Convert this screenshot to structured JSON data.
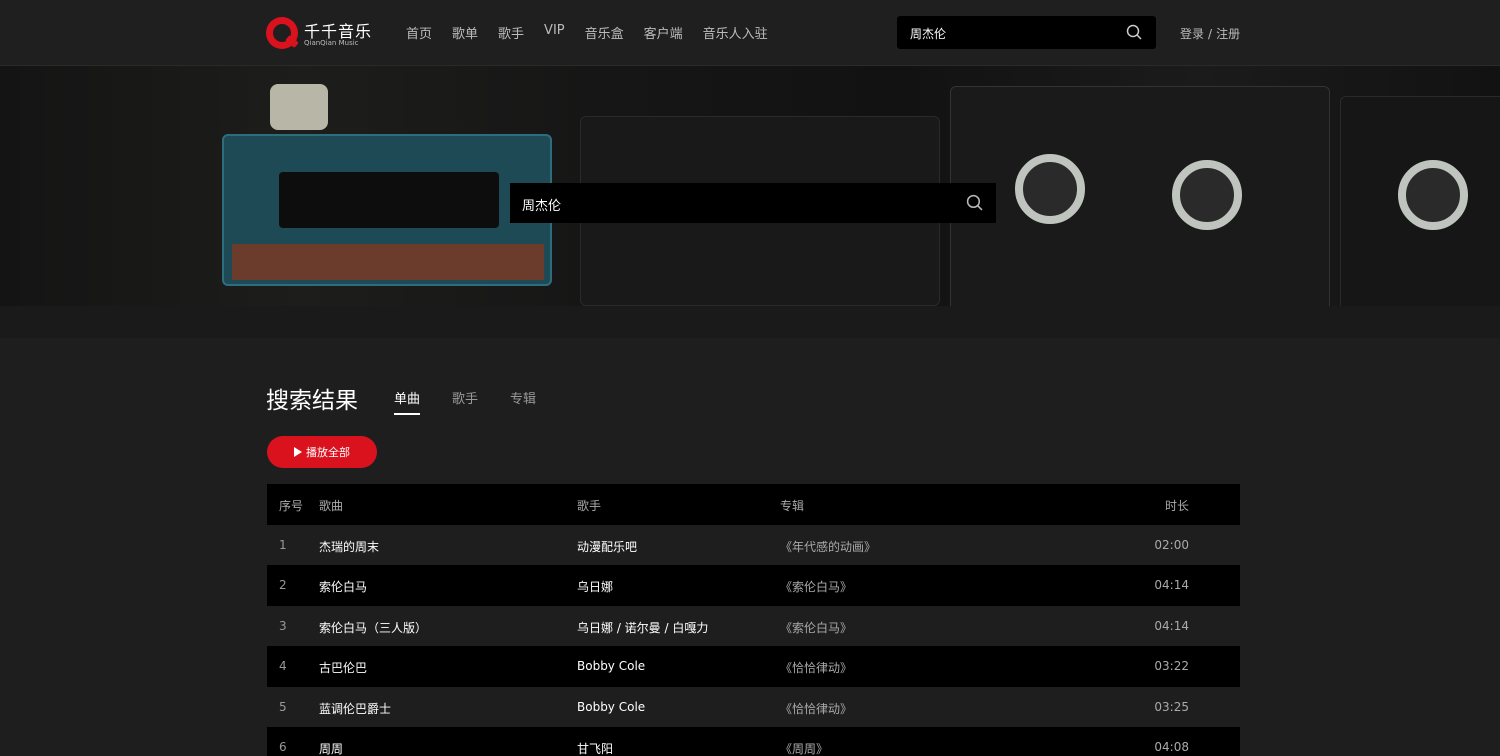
{
  "header": {
    "logo_cn": "千千音乐",
    "logo_en": "QianQian Music",
    "nav": [
      "首页",
      "歌单",
      "歌手",
      "VIP",
      "音乐盒",
      "客户端",
      "音乐人入驻"
    ],
    "search_value": "周杰伦",
    "login": "登录",
    "auth_sep": "/",
    "register": "注册"
  },
  "banner": {
    "search_value": "周杰伦"
  },
  "results": {
    "title": "搜索结果",
    "tabs": [
      "单曲",
      "歌手",
      "专辑"
    ],
    "active_tab": "单曲",
    "play_all": "播放全部",
    "columns": {
      "idx": "序号",
      "song": "歌曲",
      "artist": "歌手",
      "album": "专辑",
      "duration": "时长"
    },
    "rows": [
      {
        "idx": "1",
        "song": "杰瑞的周末",
        "artist": "动漫配乐吧",
        "album": "《年代感的动画》",
        "duration": "02:00"
      },
      {
        "idx": "2",
        "song": "索伦白马",
        "artist": "乌日娜",
        "album": "《索伦白马》",
        "duration": "04:14"
      },
      {
        "idx": "3",
        "song": "索伦白马（三人版）",
        "artist": "乌日娜 / 诺尔曼 / 白嘎力",
        "album": "《索伦白马》",
        "duration": "04:14"
      },
      {
        "idx": "4",
        "song": "古巴伦巴",
        "artist": "Bobby Cole",
        "album": "《恰恰律动》",
        "duration": "03:22"
      },
      {
        "idx": "5",
        "song": "蓝调伦巴爵士",
        "artist": "Bobby Cole",
        "album": "《恰恰律动》",
        "duration": "03:25"
      },
      {
        "idx": "6",
        "song": "周周",
        "artist": "甘飞阳",
        "album": "《周周》",
        "duration": "04:08"
      }
    ]
  },
  "colors": {
    "accent": "#d9121e",
    "bg": "#1e1e1e",
    "header_bg": "#1f1f1f",
    "row_dark": "#000000"
  },
  "icons": {
    "search": "search-icon",
    "play": "play-icon",
    "logo": "qianqian-logo-icon"
  }
}
